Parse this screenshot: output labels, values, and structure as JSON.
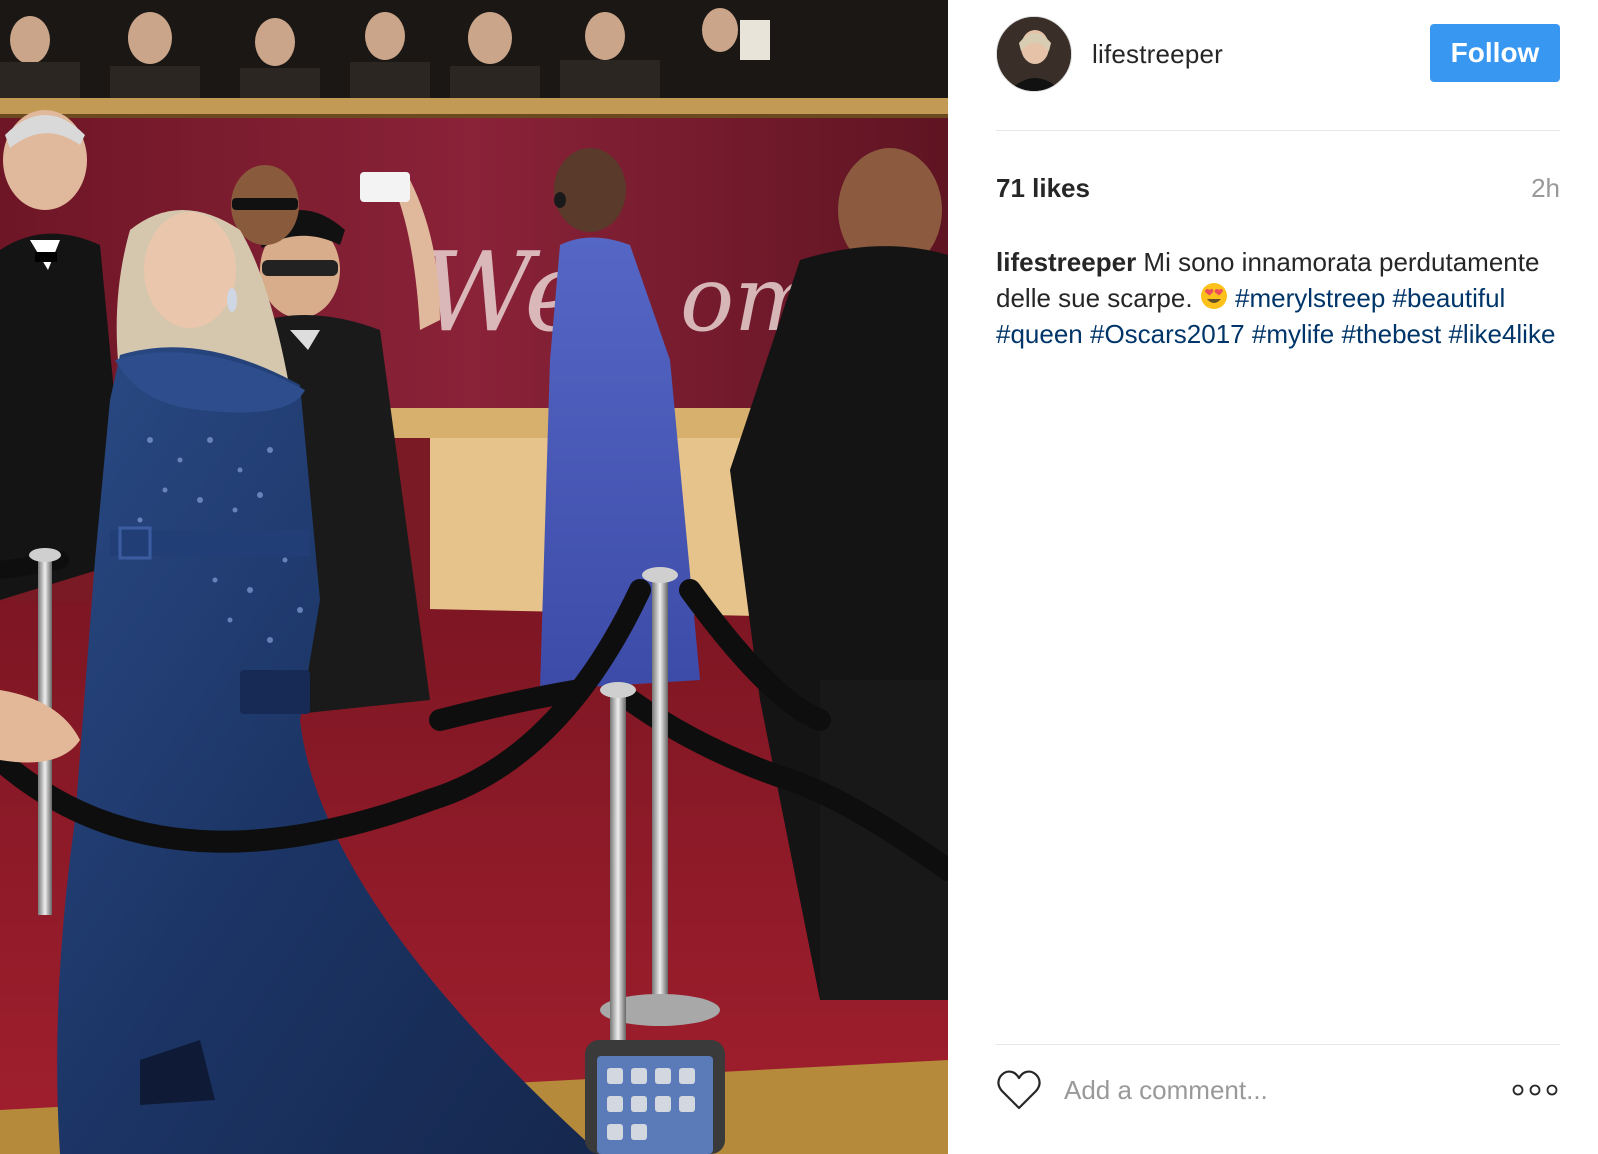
{
  "post": {
    "username": "lifestreeper",
    "follow_label": "Follow",
    "likes": "71 likes",
    "time": "2h",
    "caption": {
      "user": "lifestreeper",
      "text": "Mi sono innamorata perdutamente delle sue scarpe.",
      "emoji": "heart-eyes-emoji",
      "hashtags": [
        "#merylstreep",
        "#beautiful",
        "#queen",
        "#Oscars2017",
        "#mylife",
        "#thebest",
        "#like4like"
      ]
    },
    "comment_placeholder": "Add a comment...",
    "photo_alt": "",
    "icons": {
      "like": "heart-outline-icon",
      "more": "more-options-icon"
    }
  },
  "colors": {
    "follow_button": "#3897f0",
    "hashtag": "#003569",
    "text": "#262626",
    "muted": "#999999",
    "carpet": "#8e1b2a",
    "gown": "#1f3a6b"
  }
}
